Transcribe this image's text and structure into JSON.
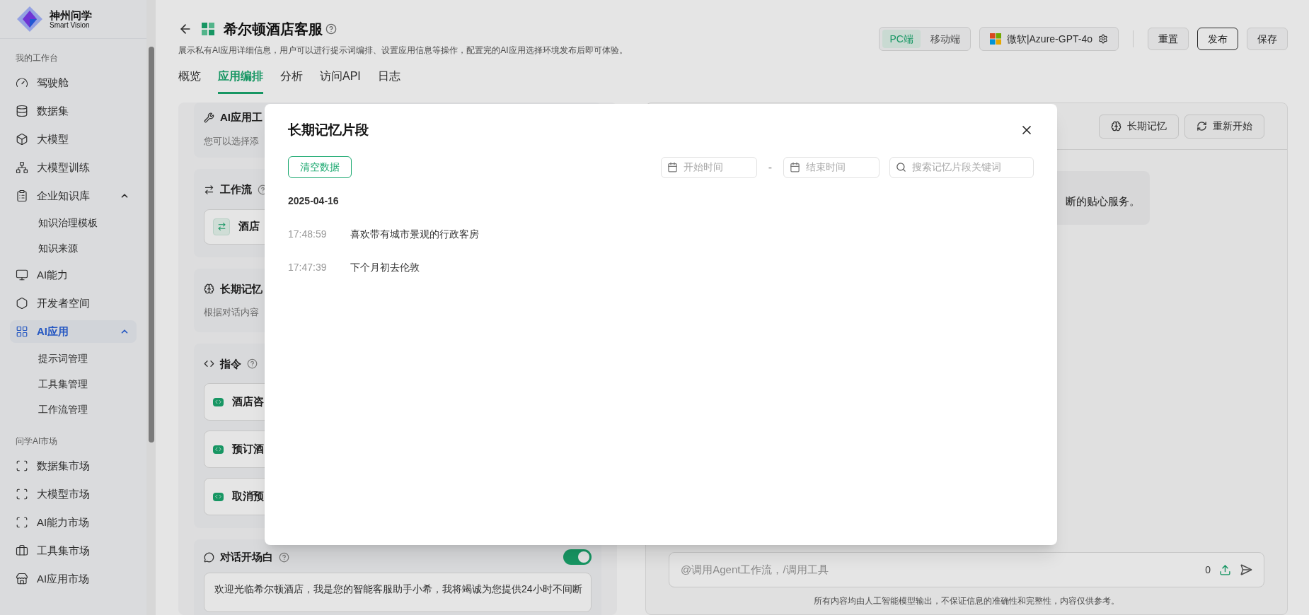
{
  "sidebar": {
    "logo": {
      "title": "神州问学",
      "subtitle": "Smart Vision"
    },
    "groups": [
      {
        "title": "我的工作台",
        "items": [
          {
            "label": "驾驶舱",
            "selected": false
          },
          {
            "label": "数据集",
            "selected": false
          },
          {
            "label": "大模型",
            "selected": false
          },
          {
            "label": "大模型训练",
            "selected": false
          },
          {
            "label": "企业知识库",
            "selected": false,
            "expanded": true,
            "children": [
              {
                "label": "知识治理模板"
              },
              {
                "label": "知识来源"
              }
            ]
          },
          {
            "label": "AI能力",
            "selected": false
          },
          {
            "label": "开发者空间",
            "selected": false
          },
          {
            "label": "AI应用",
            "selected": true,
            "expanded": true,
            "children": [
              {
                "label": "提示词管理"
              },
              {
                "label": "工具集管理"
              },
              {
                "label": "工作流管理"
              }
            ]
          }
        ]
      },
      {
        "title": "问学AI市场",
        "items": [
          {
            "label": "数据集市场",
            "selected": false
          },
          {
            "label": "大模型市场",
            "selected": false
          },
          {
            "label": "AI能力市场",
            "selected": false
          },
          {
            "label": "工具集市场",
            "selected": false
          },
          {
            "label": "AI应用市场",
            "selected": false
          }
        ]
      }
    ]
  },
  "header": {
    "title": "希尔顿酒店客服",
    "description": "展示私有AI应用详细信息，用户可以进行提示词编排、设置应用信息等操作，配置完的AI应用选择环境发布后即可体验。",
    "platforms": [
      {
        "label": "PC端",
        "selected": true
      },
      {
        "label": "移动端",
        "selected": false
      }
    ],
    "model": "微软|Azure-GPT-4o",
    "buttons": [
      {
        "label": "重置",
        "kind": "default"
      },
      {
        "label": "发布",
        "kind": "primary"
      },
      {
        "label": "保存",
        "kind": "default"
      }
    ]
  },
  "tabs": [
    {
      "label": "概览",
      "selected": false
    },
    {
      "label": "应用编排",
      "selected": true
    },
    {
      "label": "分析",
      "selected": false
    },
    {
      "label": "访问API",
      "selected": false
    },
    {
      "label": "日志",
      "selected": false
    }
  ],
  "config_sections": [
    {
      "kind": "tools",
      "title": "AI应用工",
      "help": false,
      "hint": "您可以选择添"
    },
    {
      "kind": "workflow",
      "title": "工作流",
      "help": true,
      "items": [
        "酒店"
      ]
    },
    {
      "kind": "memory",
      "title": "长期记忆",
      "help": false,
      "hint": "根据对话内容"
    },
    {
      "kind": "instructions",
      "title": "指令",
      "help": true,
      "items": [
        "酒店咨",
        "预订酒",
        "取消预"
      ]
    },
    {
      "kind": "greeting",
      "title": "对话开场白",
      "help": true,
      "on": true,
      "text": "欢迎光临希尔顿酒店，我是您的智能客服助手小希，我将竭诚为您提供24小时不间断"
    }
  ],
  "chat": {
    "buttons": [
      "长期记忆",
      "重新开始"
    ],
    "message": "断的贴心服务。",
    "input": {
      "placeholder": "@调用Agent工作流，/调用工具",
      "count": "0"
    },
    "disclaimer": "所有内容均由人工智能模型输出，不保证信息的准确性和完整性，内容仅供参考。"
  },
  "dialog": {
    "title": "长期记忆片段",
    "clear_button": "清空数据",
    "start_placeholder": "开始时间",
    "separator": "-",
    "end_placeholder": "结束时间",
    "search_placeholder": "搜索记忆片段关键词",
    "groups": [
      {
        "date": "2025-04-16",
        "entries": [
          {
            "time": "17:48:59",
            "text": "喜欢带有城市景观的行政客房"
          },
          {
            "time": "17:47:39",
            "text": "下个月初去伦敦"
          }
        ]
      }
    ]
  }
}
